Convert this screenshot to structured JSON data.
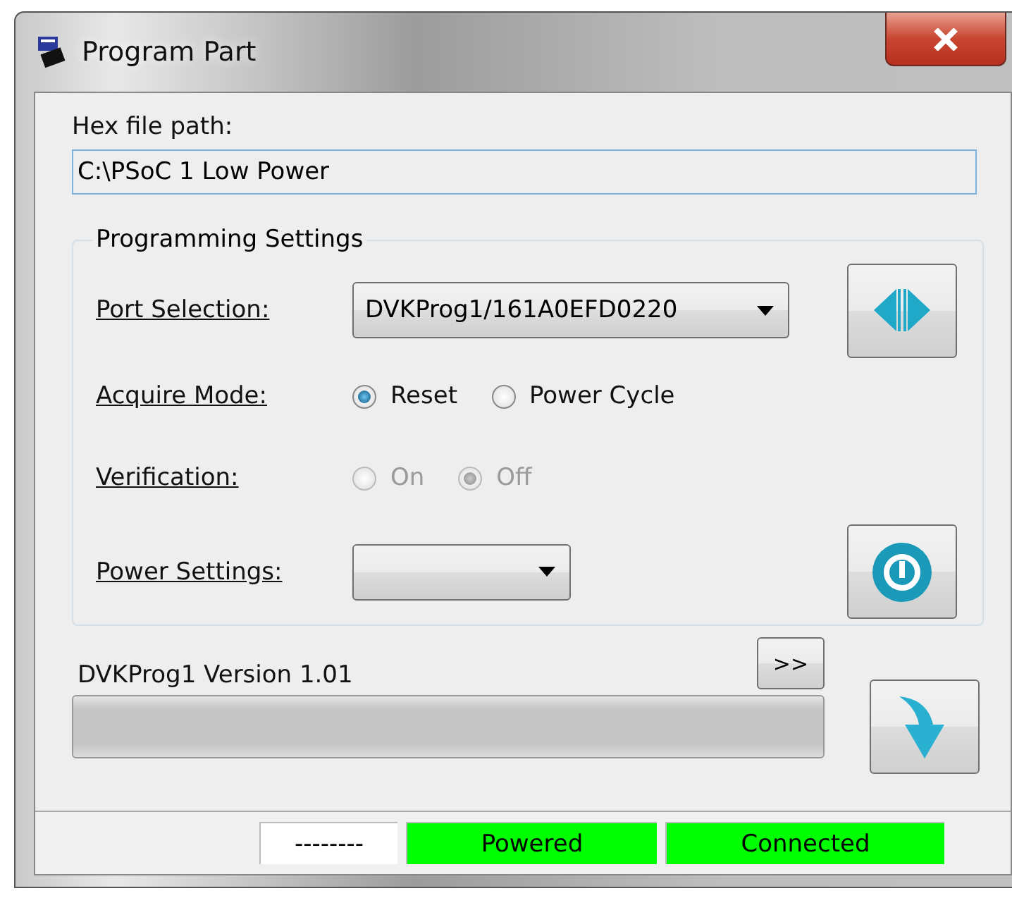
{
  "window": {
    "title": "Program Part"
  },
  "hex_file": {
    "label": "Hex file path:",
    "value": "C:\\PSoC 1 Low Power"
  },
  "group": {
    "title": "Programming Settings",
    "port": {
      "label": "Port Selection:",
      "value": "DVKProg1/161A0EFD0220"
    },
    "acquire": {
      "label": "Acquire Mode:",
      "options": [
        {
          "label": "Reset",
          "selected": true,
          "disabled": false
        },
        {
          "label": "Power Cycle",
          "selected": false,
          "disabled": false
        }
      ]
    },
    "verification": {
      "label": "Verification:",
      "options": [
        {
          "label": "On",
          "selected": false,
          "disabled": true
        },
        {
          "label": "Off",
          "selected": true,
          "disabled": true
        }
      ]
    },
    "power": {
      "label": "Power Settings:"
    }
  },
  "version": {
    "text": "DVKProg1 Version 1.01",
    "more_button": ">>"
  },
  "progress": {
    "level": 0
  },
  "status_bar": [
    {
      "text": "--------",
      "color": "#ffffff"
    },
    {
      "text": "Powered",
      "color": "#00ff00"
    },
    {
      "text": "Connected",
      "color": "#00ff00"
    }
  ]
}
